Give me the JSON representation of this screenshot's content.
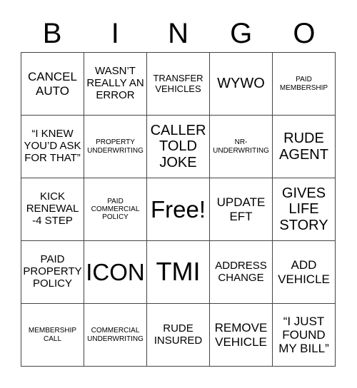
{
  "header": [
    "B",
    "I",
    "N",
    "G",
    "O"
  ],
  "cells": [
    [
      "CANCEL AUTO",
      "WASN’T REALLY AN ERROR",
      "TRANSFER VEHICLES",
      "WYWO",
      "PAID MEMBERSHIP"
    ],
    [
      "“I KNEW YOU’D ASK FOR THAT”",
      "PROPERTY UNDERWRITING",
      "CALLER TOLD JOKE",
      "NR-UNDERWRITING",
      "RUDE AGENT"
    ],
    [
      "KICK RENEWAL -4 STEP",
      "PAID COMMERCIAL POLICY",
      "Free!",
      "UPDATE EFT",
      "GIVES LIFE STORY"
    ],
    [
      "PAID PROPERTY POLICY",
      "ICON",
      "TMI",
      "ADDRESS CHANGE",
      "ADD VEHICLE"
    ],
    [
      "MEMBERSHIP CALL",
      "COMMERCIAL UNDERWRITING",
      "RUDE INSURED",
      "REMOVE VEHICLE",
      "“I JUST FOUND MY BILL”"
    ]
  ]
}
